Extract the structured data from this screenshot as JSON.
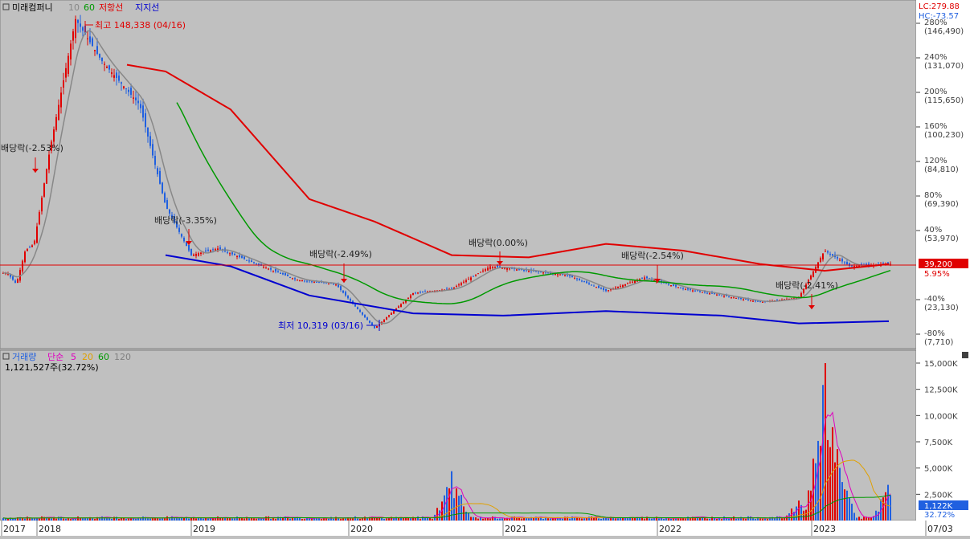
{
  "header": {
    "title": "미래컴퍼니",
    "ma_short": "10",
    "ma_mid": "60",
    "resistance_label": "저항선",
    "support_label": "지지선",
    "lc_label": "LC:279.88",
    "hc_label": "HC:-73.57"
  },
  "volume_header": {
    "title": "거래량",
    "simple_label": "단순",
    "ma5": "5",
    "ma20": "20",
    "ma60": "60",
    "ma120": "120",
    "last_volume": "1,121,527주(32.72%)"
  },
  "price_axis": [
    {
      "pct": "280%",
      "price": "(146,490)"
    },
    {
      "pct": "240%",
      "price": "(131,070)"
    },
    {
      "pct": "200%",
      "price": "(115,650)"
    },
    {
      "pct": "160%",
      "price": "(100,230)"
    },
    {
      "pct": "120%",
      "price": "(84,810)"
    },
    {
      "pct": "80%",
      "price": "(69,390)"
    },
    {
      "pct": "40%",
      "price": "(53,970)"
    },
    {
      "pct": "-40%",
      "price": "(23,130)"
    },
    {
      "pct": "-80%",
      "price": "(7,710)"
    }
  ],
  "current": {
    "price_label": "39,200",
    "pct_label": "5.95%"
  },
  "volume_axis": [
    "15,000K",
    "12,500K",
    "10,000K",
    "7,500K",
    "5,000K",
    "2,500K"
  ],
  "volume_current": {
    "vol_label": "1,122K",
    "pct_label": "32.72%"
  },
  "date_axis": [
    "2017",
    "2018",
    "2019",
    "2020",
    "2021",
    "2022",
    "2023",
    "07/03"
  ],
  "annotations": {
    "high": "최고 148,338 (04/16)",
    "low": "최저 10,319 (03/16)",
    "div1": "배당락(-2.53%)",
    "div2": "배당락(-3.35%)",
    "div3": "배당락(-2.49%)",
    "div4": "배당락(0.00%)",
    "div5": "배당락(-2.54%)",
    "div6": "배당락(-2.41%)"
  },
  "colors": {
    "resistance": "#e00000",
    "support": "#0000d0",
    "ma10": "#888888",
    "ma60": "#009900",
    "up": "#e00000",
    "down": "#2060e0",
    "ma5_vol": "#e000c0",
    "ma20_vol": "#e0a000",
    "ma60_vol": "#009900"
  },
  "chart_data": [
    {
      "type": "candlestick",
      "title": "미래컴퍼니",
      "x_range": [
        "2017",
        "2023-07-03"
      ],
      "y_range": [
        7710,
        146490
      ],
      "close_approx": [
        [
          "2017-03",
          35000
        ],
        [
          "2017-06",
          30000
        ],
        [
          "2017-09",
          45000
        ],
        [
          "2017-12",
          48000
        ],
        [
          "2018-02",
          90000
        ],
        [
          "2018-04",
          148338
        ],
        [
          "2018-06",
          130000
        ],
        [
          "2018-09",
          110000
        ],
        [
          "2018-11",
          65000
        ],
        [
          "2019-01",
          43000
        ],
        [
          "2019-03",
          46000
        ],
        [
          "2019-06",
          39000
        ],
        [
          "2019-09",
          32000
        ],
        [
          "2019-12",
          30000
        ],
        [
          "2020-03",
          10319
        ],
        [
          "2020-06",
          26000
        ],
        [
          "2020-09",
          28000
        ],
        [
          "2020-12",
          38000
        ],
        [
          "2021-03",
          36000
        ],
        [
          "2021-06",
          34000
        ],
        [
          "2021-09",
          27000
        ],
        [
          "2021-12",
          33000
        ],
        [
          "2022-03",
          28000
        ],
        [
          "2022-06",
          25000
        ],
        [
          "2022-09",
          22000
        ],
        [
          "2022-12",
          24000
        ],
        [
          "2023-02",
          45000
        ],
        [
          "2023-04",
          38000
        ],
        [
          "2023-07",
          39200
        ]
      ],
      "resistance_line_approx": [
        [
          "2018-08",
          128000
        ],
        [
          "2018-11",
          125000
        ],
        [
          "2019-04",
          108000
        ],
        [
          "2019-10",
          68000
        ],
        [
          "2020-03",
          58000
        ],
        [
          "2020-09",
          43000
        ],
        [
          "2021-03",
          42000
        ],
        [
          "2021-09",
          48000
        ],
        [
          "2022-03",
          45000
        ],
        [
          "2022-09",
          39000
        ],
        [
          "2023-02",
          36000
        ],
        [
          "2023-07",
          39000
        ]
      ],
      "support_line_approx": [
        [
          "2018-11",
          43000
        ],
        [
          "2019-04",
          38000
        ],
        [
          "2019-10",
          25000
        ],
        [
          "2020-06",
          17000
        ],
        [
          "2021-01",
          16000
        ],
        [
          "2021-09",
          18000
        ],
        [
          "2022-06",
          16000
        ],
        [
          "2022-12",
          12500
        ],
        [
          "2023-07",
          13500
        ]
      ],
      "current_price": 39200
    },
    {
      "type": "bar",
      "title": "거래량",
      "unit": "K shares",
      "y_range": [
        0,
        15000
      ],
      "peaks": [
        [
          "2020-09",
          4700
        ],
        [
          "2022-12",
          1900
        ],
        [
          "2023-02",
          15000
        ],
        [
          "2023-03",
          6800
        ],
        [
          "2023-07",
          3400
        ]
      ],
      "last_volume": 1121527
    }
  ]
}
